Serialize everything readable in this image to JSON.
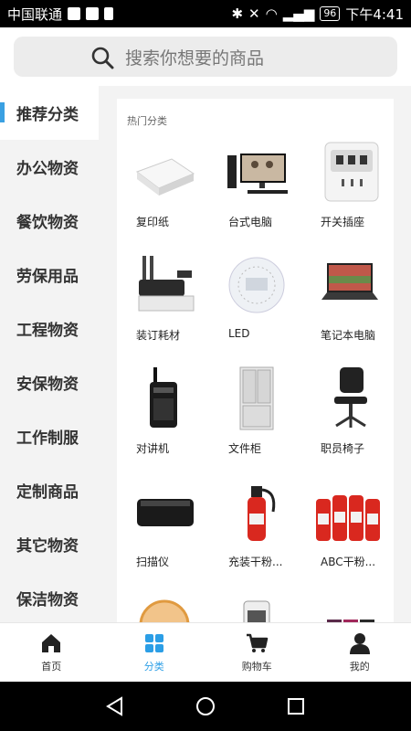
{
  "status": {
    "carrier": "中国联通",
    "battery": "96",
    "time": "下午4:41"
  },
  "search": {
    "placeholder": "搜索你想要的商品"
  },
  "sidebar": {
    "items": [
      {
        "label": "推荐分类",
        "active": true
      },
      {
        "label": "办公物资",
        "active": false
      },
      {
        "label": "餐饮物资",
        "active": false
      },
      {
        "label": "劳保用品",
        "active": false
      },
      {
        "label": "工程物资",
        "active": false
      },
      {
        "label": "安保物资",
        "active": false
      },
      {
        "label": "工作制服",
        "active": false
      },
      {
        "label": "定制商品",
        "active": false
      },
      {
        "label": "其它物资",
        "active": false
      },
      {
        "label": "保洁物资",
        "active": false
      }
    ]
  },
  "content": {
    "section_title": "热门分类",
    "products": [
      {
        "label": "复印纸",
        "icon": "paper-icon"
      },
      {
        "label": "台式电脑",
        "icon": "desktop-icon"
      },
      {
        "label": "开关插座",
        "icon": "socket-icon"
      },
      {
        "label": "装订耗材",
        "icon": "binder-icon"
      },
      {
        "label": "LED",
        "icon": "led-icon"
      },
      {
        "label": "笔记本电脑",
        "icon": "laptop-icon"
      },
      {
        "label": "对讲机",
        "icon": "walkie-talkie-icon"
      },
      {
        "label": "文件柜",
        "icon": "cabinet-icon"
      },
      {
        "label": "职员椅子",
        "icon": "chair-icon"
      },
      {
        "label": "扫描仪",
        "icon": "scanner-icon"
      },
      {
        "label": "充装干粉...",
        "icon": "extinguisher-icon"
      },
      {
        "label": "ABC干粉...",
        "icon": "extinguishers-icon"
      },
      {
        "label": "",
        "icon": "heater-icon"
      },
      {
        "label": "",
        "icon": "fan-icon"
      },
      {
        "label": "",
        "icon": "printer-ink-icon"
      }
    ]
  },
  "tabbar": {
    "tabs": [
      {
        "label": "首页",
        "icon": "home-icon",
        "active": false
      },
      {
        "label": "分类",
        "icon": "category-icon",
        "active": true
      },
      {
        "label": "购物车",
        "icon": "cart-icon",
        "active": false
      },
      {
        "label": "我的",
        "icon": "user-icon",
        "active": false
      }
    ]
  },
  "colors": {
    "accent": "#2b9ee6",
    "indicator": "#3aa0e2"
  }
}
